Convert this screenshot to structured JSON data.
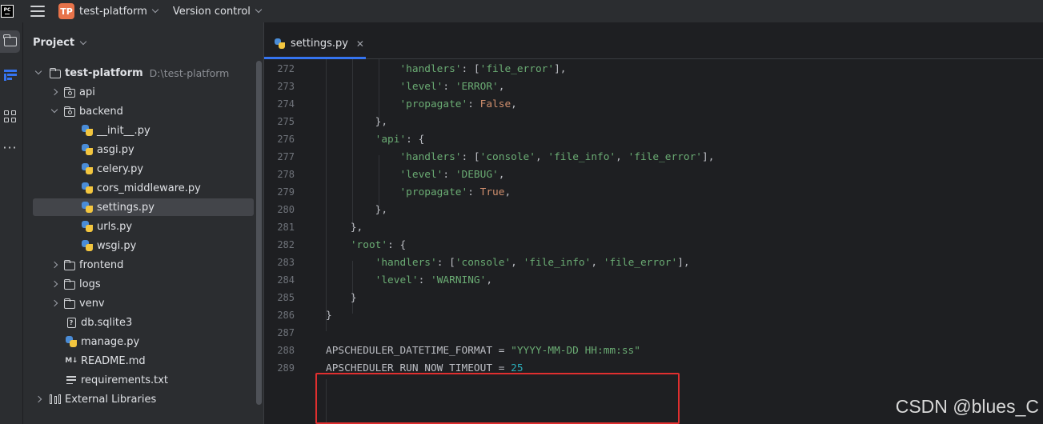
{
  "titlebar": {
    "app_logo": "PC",
    "project_badge": "TP",
    "project_name": "test-platform",
    "vcs_label": "Version control"
  },
  "panel": {
    "title": "Project"
  },
  "tree": [
    {
      "label": "test-platform",
      "extra": "D:\\test-platform",
      "icon": "folder-icon"
    },
    {
      "label": "api",
      "icon": "package-folder-icon"
    },
    {
      "label": "backend",
      "icon": "package-folder-icon"
    },
    {
      "label": "__init__.py",
      "icon": "python-file-icon"
    },
    {
      "label": "asgi.py",
      "icon": "python-file-icon"
    },
    {
      "label": "celery.py",
      "icon": "python-file-icon"
    },
    {
      "label": "cors_middleware.py",
      "icon": "python-file-icon"
    },
    {
      "label": "settings.py",
      "icon": "python-file-icon"
    },
    {
      "label": "urls.py",
      "icon": "python-file-icon"
    },
    {
      "label": "wsgi.py",
      "icon": "python-file-icon"
    },
    {
      "label": "frontend",
      "icon": "folder-icon"
    },
    {
      "label": "logs",
      "icon": "folder-icon"
    },
    {
      "label": "venv",
      "icon": "folder-icon"
    },
    {
      "label": "db.sqlite3",
      "icon": "database-file-icon"
    },
    {
      "label": "manage.py",
      "icon": "python-file-icon"
    },
    {
      "label": "README.md",
      "icon": "markdown-file-icon"
    },
    {
      "label": "requirements.txt",
      "icon": "text-file-icon"
    },
    {
      "label": "External Libraries",
      "icon": "library-icon"
    }
  ],
  "editor": {
    "tab_label": "settings.py",
    "lines": [
      {
        "n": "272",
        "text": "            'handlers': ['file_error'],"
      },
      {
        "n": "273",
        "text": "            'level': 'ERROR',"
      },
      {
        "n": "274",
        "text": "            'propagate': False,"
      },
      {
        "n": "275",
        "text": "        },"
      },
      {
        "n": "276",
        "text": "        'api': {"
      },
      {
        "n": "277",
        "text": "            'handlers': ['console', 'file_info', 'file_error'],"
      },
      {
        "n": "278",
        "text": "            'level': 'DEBUG',"
      },
      {
        "n": "279",
        "text": "            'propagate': True,"
      },
      {
        "n": "280",
        "text": "        },"
      },
      {
        "n": "281",
        "text": "    },"
      },
      {
        "n": "282",
        "text": "    'root': {"
      },
      {
        "n": "283",
        "text": "        'handlers': ['console', 'file_info', 'file_error'],"
      },
      {
        "n": "284",
        "text": "        'level': 'WARNING',"
      },
      {
        "n": "285",
        "text": "    }"
      },
      {
        "n": "286",
        "text": "}"
      },
      {
        "n": "287",
        "text": ""
      },
      {
        "n": "288",
        "text": "APSCHEDULER_DATETIME_FORMAT = \"YYYY-MM-DD HH:mm:ss\""
      },
      {
        "n": "289",
        "text": "APSCHEDULER_RUN_NOW_TIMEOUT = 25"
      }
    ]
  },
  "watermark": "CSDN @blues_C",
  "colors": {
    "accent": "#3574f0",
    "string": "#6aab73",
    "keyword": "#cf8e6d",
    "number": "#2aacb8",
    "highlight_box": "#e02f2f"
  }
}
